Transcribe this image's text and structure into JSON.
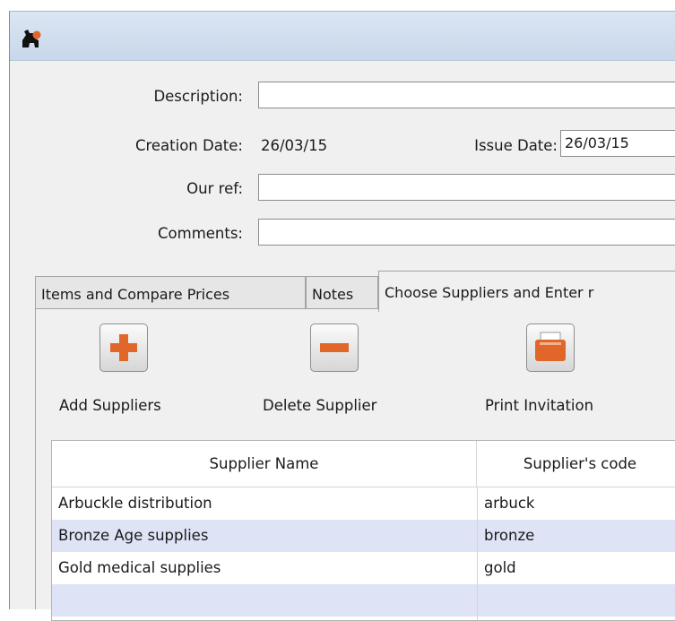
{
  "form": {
    "description_label": "Description:",
    "description_value": "",
    "creation_date_label": "Creation Date:",
    "creation_date_value": "26/03/15",
    "issue_date_label": "Issue Date:",
    "issue_date_value": "26/03/15",
    "our_ref_label": "Our ref:",
    "our_ref_value": "",
    "comments_label": "Comments:",
    "comments_value": ""
  },
  "tabs": [
    {
      "label": "Items and Compare Prices",
      "active": false
    },
    {
      "label": "Notes",
      "active": false
    },
    {
      "label": "Choose Suppliers and Enter r",
      "active": true
    }
  ],
  "toolbar": {
    "add_label": "Add Suppliers",
    "delete_label": "Delete Supplier",
    "print_label": "Print Invitation"
  },
  "table": {
    "columns": [
      "Supplier Name",
      "Supplier's code"
    ],
    "rows": [
      {
        "name": "Arbuckle distribution",
        "code": "arbuck"
      },
      {
        "name": "Bronze Age supplies",
        "code": "bronze"
      },
      {
        "name": "Gold medical supplies",
        "code": "gold"
      },
      {
        "name": "",
        "code": ""
      }
    ]
  },
  "colors": {
    "accent_orange": "#e0662a",
    "row_alt": "#dfe3f6",
    "titlebar": "#c8d7ea"
  },
  "icons": {
    "app": "app-logo-icon",
    "add": "plus-icon",
    "delete": "minus-icon",
    "print": "printer-icon"
  }
}
